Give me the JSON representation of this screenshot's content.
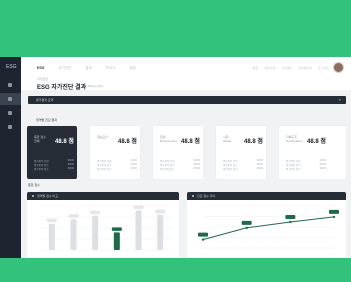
{
  "header": {
    "nav": [
      "ESG",
      "자가진단",
      "결과",
      "보고서",
      "설정"
    ],
    "right_links": [
      "알림",
      "공지사항",
      "고객센터",
      "마이페이지",
      "로그아웃"
    ],
    "breadcrumb": "자가진단",
    "page_title": "ESG 자가진단 결과",
    "page_subtitle": "2023년 상반기"
  },
  "sidebar": {
    "logo": "ESG"
  },
  "darkbar": {
    "label": "평가결과 요약",
    "search_icon": "search-icon"
  },
  "sections": {
    "summary_label": "영역별 진단 결과",
    "chart_label": "종합 점수"
  },
  "cards": [
    {
      "area": "종합 점수",
      "area_sub": "전체",
      "score": "48.8 점",
      "rows": [
        [
          "평가항목 총점",
          "00/00"
        ],
        [
          "평가항목 점수",
          "00/00"
        ],
        [
          "평가항목 점수",
          "00/00"
        ]
      ]
    },
    {
      "area": "정보공시",
      "area_sub": "",
      "score": "48.8 점",
      "rows": [
        [
          "평가항목 총점",
          "00/00"
        ],
        [
          "평가항목 점수",
          "00/00"
        ],
        [
          "평가항목 점수",
          "00/00"
        ]
      ]
    },
    {
      "area": "환경",
      "area_sub": "Environment",
      "score": "48.8 점",
      "rows": [
        [
          "평가항목 총점",
          "00/00"
        ],
        [
          "평가항목 점수",
          "00/00"
        ],
        [
          "평가항목 점수",
          "00/00"
        ]
      ]
    },
    {
      "area": "사회",
      "area_sub": "Social",
      "score": "48.8 점",
      "rows": [
        [
          "평가항목 총점",
          "00/00"
        ],
        [
          "평가항목 점수",
          "00/00"
        ],
        [
          "평가항목 점수",
          "00/00"
        ]
      ]
    },
    {
      "area": "지배구조",
      "area_sub": "Governance",
      "score": "48.8 점",
      "rows": [
        [
          "평가항목 총점",
          "00/00"
        ],
        [
          "평가항목 점수",
          "00/00"
        ],
        [
          "평가항목 점수",
          "00/00"
        ]
      ]
    }
  ],
  "panels": {
    "left_title": "영역별 점수 비교",
    "right_title": "진단 점수 추이"
  },
  "chart_data": [
    {
      "type": "bar",
      "title": "영역별 점수 비교",
      "categories": [
        "",
        "",
        "",
        "",
        "",
        ""
      ],
      "values": [
        60,
        70,
        78,
        40,
        90,
        80
      ],
      "highlight_index": 3,
      "data_labels": [
        "",
        "",
        "",
        "",
        "",
        ""
      ],
      "ylim": [
        0,
        100
      ],
      "grid": true,
      "colors": {
        "bar": "#dcdfe3",
        "highlight": "#1f6b49"
      }
    },
    {
      "type": "line",
      "title": "진단 점수 추이",
      "x": [
        "",
        "",
        "",
        ""
      ],
      "y": [
        20,
        48,
        62,
        74
      ],
      "data_labels": [
        "",
        "",
        "",
        ""
      ],
      "ylim": [
        0,
        100
      ],
      "grid": true,
      "colors": {
        "line": "#1f6b49"
      }
    }
  ],
  "colors": {
    "brand_green": "#33c27b",
    "dark": "#262d37"
  }
}
